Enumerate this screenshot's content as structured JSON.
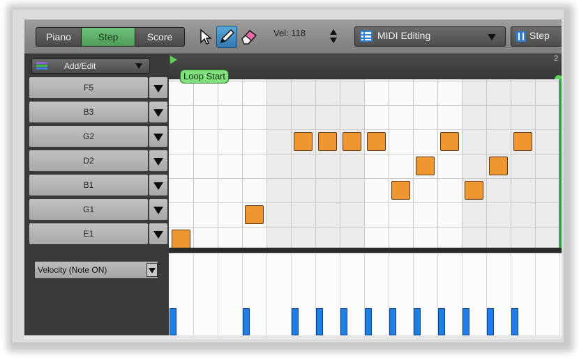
{
  "toolbar": {
    "mode_tabs": [
      "Piano",
      "Step",
      "Score"
    ],
    "active_mode": "Step",
    "velocity_label": "Vel: 118",
    "editing_dropdown": "MIDI Editing",
    "view_dropdown": "Step"
  },
  "left_panel": {
    "add_edit_label": "Add/Edit",
    "tracks": [
      "F5",
      "B3",
      "G2",
      "D2",
      "B1",
      "G1",
      "E1"
    ],
    "velocity_selector": "Velocity (Note ON)"
  },
  "ruler": {
    "loop_start_label": "Loop Start",
    "marker_number": "2"
  },
  "colors": {
    "note": "#ef9630",
    "active_tab": "#5aae62",
    "loop_marker": "#7fe27c",
    "velocity_bar": "#1f7fe6"
  },
  "grid": {
    "columns": 16,
    "notes": [
      {
        "step": 0,
        "track": "E1"
      },
      {
        "step": 3,
        "track": "G1"
      },
      {
        "step": 5,
        "track": "G2"
      },
      {
        "step": 6,
        "track": "G2"
      },
      {
        "step": 7,
        "track": "G2"
      },
      {
        "step": 8,
        "track": "G2"
      },
      {
        "step": 9,
        "track": "B1"
      },
      {
        "step": 10,
        "track": "D2"
      },
      {
        "step": 11,
        "track": "G2"
      },
      {
        "step": 12,
        "track": "B1"
      },
      {
        "step": 13,
        "track": "D2"
      },
      {
        "step": 14,
        "track": "G2"
      }
    ],
    "velocity_level": 0.3
  }
}
